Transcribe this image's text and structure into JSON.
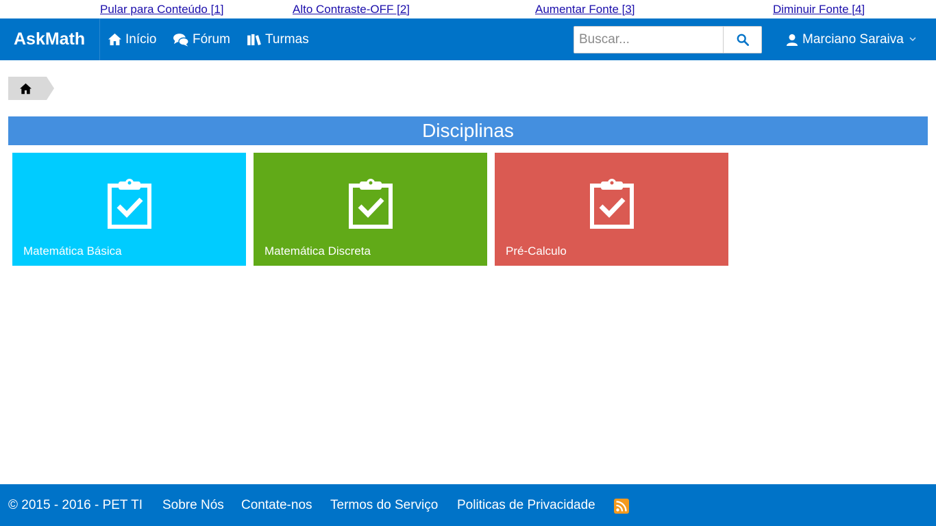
{
  "accessibility": {
    "skip_content": "Pular para Conteúdo [1]",
    "high_contrast": "Alto Contraste-OFF [2]",
    "increase_font": "Aumentar Fonte [3]",
    "decrease_font": "Diminuir Fonte [4]"
  },
  "navbar": {
    "brand": "AskMath",
    "items": [
      {
        "label": "Início",
        "icon": "home-icon"
      },
      {
        "label": "Fórum",
        "icon": "chat-icon"
      },
      {
        "label": "Turmas",
        "icon": "books-icon"
      }
    ],
    "search": {
      "placeholder": "Buscar...",
      "value": ""
    },
    "user": {
      "name": "Marciano Saraiva"
    }
  },
  "breadcrumb": {
    "items": [
      {
        "icon": "home-icon"
      }
    ]
  },
  "main": {
    "title": "Disciplinas",
    "tiles": [
      {
        "label": "Matemática Básica",
        "color": "#00ccff",
        "icon": "clipboard-check-icon"
      },
      {
        "label": "Matemática Discreta",
        "color": "#61aa18",
        "icon": "clipboard-check-icon"
      },
      {
        "label": "Pré-Calculo",
        "color": "#da5a52",
        "icon": "clipboard-check-icon"
      }
    ]
  },
  "footer": {
    "copyright": "© 2015 - 2016 - PET TI",
    "links": [
      "Sobre Nós",
      "Contate-nos",
      "Termos do Serviço",
      "Politicas de Privacidade"
    ],
    "rss_icon": "rss-icon"
  },
  "colors": {
    "navbar": "#0073c8",
    "section_header": "#448fdf",
    "link": "#1a0dab"
  }
}
